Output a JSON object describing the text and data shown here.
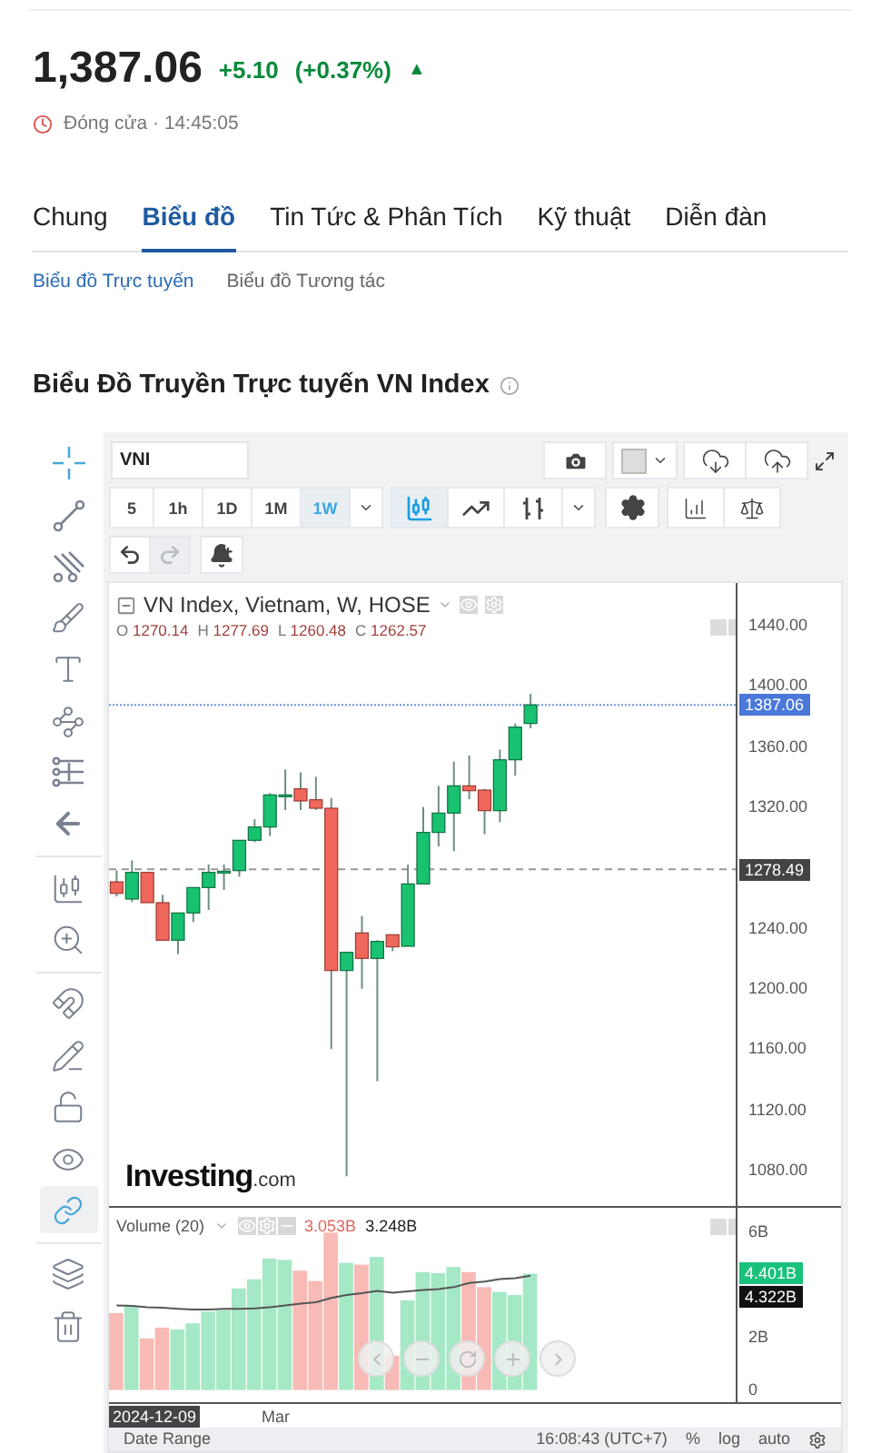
{
  "quote": {
    "price": "1,387.06",
    "change": "+5.10",
    "change_percent": "(+0.37%)",
    "arrow": "▲",
    "status": "Đóng cửa · 14:45:05"
  },
  "tabs": [
    {
      "label": "Chung",
      "selected": false
    },
    {
      "label": "Biểu đồ",
      "selected": true
    },
    {
      "label": "Tin Tức & Phân Tích",
      "selected": false
    },
    {
      "label": "Kỹ thuật",
      "selected": false
    },
    {
      "label": "Diễn đàn",
      "selected": false
    }
  ],
  "subtabs": [
    {
      "label": "Biểu đồ Trực tuyến",
      "selected": true
    },
    {
      "label": "Biểu đồ Tương tác",
      "selected": false
    }
  ],
  "section_title": "Biểu Đồ Truyền Trực tuyến VN Index",
  "chart_widget": {
    "symbol": "VNI",
    "intervals": [
      {
        "label": "5",
        "selected": false
      },
      {
        "label": "1h",
        "selected": false
      },
      {
        "label": "1D",
        "selected": false
      },
      {
        "label": "1M",
        "selected": false
      },
      {
        "label": "1W",
        "selected": true
      }
    ],
    "chart_types": [
      {
        "kind": "candles",
        "selected": true
      },
      {
        "kind": "line",
        "selected": false
      },
      {
        "kind": "bars",
        "selected": false
      }
    ],
    "history": [
      {
        "kind": "undo",
        "disabled": false
      },
      {
        "kind": "redo",
        "disabled": true
      }
    ],
    "left_tool_groups": [
      [
        {
          "kind": "crosshair",
          "selected": true
        },
        {
          "kind": "trend-line",
          "selected": false
        },
        {
          "kind": "fork",
          "selected": false
        },
        {
          "kind": "brush",
          "selected": false
        },
        {
          "kind": "text",
          "selected": false
        },
        {
          "kind": "pattern",
          "selected": false
        },
        {
          "kind": "measure",
          "selected": false
        },
        {
          "kind": "back",
          "selected": false
        }
      ],
      [
        {
          "kind": "candle-ruler",
          "selected": false
        },
        {
          "kind": "zoom",
          "selected": false
        }
      ],
      [
        {
          "kind": "magnet",
          "selected": false
        },
        {
          "kind": "pencil-lock",
          "selected": false
        },
        {
          "kind": "unlock",
          "selected": false
        },
        {
          "kind": "eye",
          "selected": false
        },
        {
          "kind": "link",
          "selected": true
        }
      ],
      [
        {
          "kind": "layers",
          "selected": false
        },
        {
          "kind": "trash",
          "selected": false
        }
      ]
    ],
    "price_chart": {
      "legend": {
        "title": "VN Index, Vietnam, W, HOSE",
        "ohlc": [
          {
            "label": "O",
            "value": "1270.14"
          },
          {
            "label": "H",
            "value": "1277.69"
          },
          {
            "label": "L",
            "value": "1260.48"
          },
          {
            "label": "C",
            "value": "1262.57"
          }
        ]
      },
      "watermark_logo": {
        "brand": "Investing",
        "suffix": ".com"
      },
      "chart_data": {
        "type": "candlestick",
        "categories": [
          null,
          null,
          null,
          null,
          null,
          null,
          null,
          null,
          null,
          null,
          null,
          null,
          null,
          null,
          null,
          null,
          null,
          null,
          null,
          null,
          null,
          null,
          null,
          null,
          null,
          null,
          null,
          null,
          null,
          null,
          null,
          null,
          null,
          null,
          null,
          null,
          null,
          null,
          null,
          null,
          null
        ],
        "ohlc": [
          [
            1270.14,
            1277.69,
            1260.48,
            1262.57
          ],
          [
            1258.8,
            1284.4,
            1256.8,
            1276.4
          ],
          [
            1276.4,
            1276.4,
            1256.4,
            1256.4
          ],
          [
            1256.4,
            1261.6,
            1231.6,
            1231.6
          ],
          [
            1231.6,
            1249.6,
            1222.4,
            1249.6
          ],
          [
            1249.6,
            1266.4,
            1243.6,
            1266.4
          ],
          [
            1266.4,
            1281.6,
            1251.6,
            1276.4
          ],
          [
            1276.4,
            1281.6,
            1264.8,
            1277.2
          ],
          [
            1277.6,
            1297.6,
            1273.6,
            1297.6
          ],
          [
            1297.6,
            1311.6,
            1296.4,
            1306.4
          ],
          [
            1306.4,
            1328.8,
            1300.4,
            1327.6
          ],
          [
            1326.8,
            1344.4,
            1317.6,
            1327.6
          ],
          [
            1331.6,
            1342.4,
            1317.6,
            1323.6
          ],
          [
            1324.4,
            1339.6,
            1317.6,
            1318.8
          ],
          [
            1318.8,
            1325.6,
            1159.6,
            1211.6
          ],
          [
            1211.6,
            1223.6,
            1075.6,
            1223.6
          ],
          [
            1236.4,
            1247.6,
            1199.6,
            1219.6
          ],
          [
            1219.6,
            1231.6,
            1138.4,
            1230.8
          ],
          [
            1235.2,
            1235.2,
            1224.4,
            1227.2
          ],
          [
            1227.6,
            1281.6,
            1227.6,
            1268.8
          ],
          [
            1268.8,
            1319.6,
            1268.8,
            1302.8
          ],
          [
            1302.8,
            1333.6,
            1293.6,
            1315.6
          ],
          [
            1315.6,
            1349.6,
            1290.4,
            1333.6
          ],
          [
            1333.6,
            1353.6,
            1324.8,
            1330.4
          ],
          [
            1330.8,
            1331.6,
            1301.6,
            1317.2
          ],
          [
            1317.2,
            1357.6,
            1309.6,
            1350.8
          ],
          [
            1350.8,
            1374.8,
            1340.4,
            1372.4
          ],
          [
            1374.8,
            1394.4,
            1371.6,
            1387.06
          ],
          null,
          null,
          null,
          null,
          null,
          null,
          null,
          null,
          null,
          null,
          null,
          null,
          null
        ],
        "ylim": [
          1056,
          1467.6
        ],
        "yticks": [
          {
            "value": 1440,
            "label": "1440.00"
          },
          {
            "value": 1400,
            "label": "1400.00"
          },
          {
            "value": 1360,
            "label": "1360.00"
          },
          {
            "value": 1320,
            "label": "1320.00"
          },
          {
            "value": 1240,
            "label": "1240.00"
          },
          {
            "value": 1200,
            "label": "1200.00"
          },
          {
            "value": 1160,
            "label": "1160.00"
          },
          {
            "value": 1120,
            "label": "1120.00"
          },
          {
            "value": 1080,
            "label": "1080.00"
          }
        ],
        "ref_lines": [
          {
            "axis": "y",
            "value": 1387.06,
            "label": "1387.06",
            "color": "#4a78d9"
          },
          {
            "axis": "y",
            "value": 1278.49,
            "label": "1278.49",
            "color": "#444444"
          }
        ]
      }
    },
    "volume": {
      "title": "Volume (20)",
      "value_1": "3.053B",
      "value_2": "3.248B",
      "last_volume_label": "4.401B",
      "average_label": "4.322B",
      "chart_data": {
        "type": "bar",
        "stacked": true,
        "categories": [
          null,
          null,
          null,
          null,
          null,
          null,
          null,
          null,
          null,
          null,
          null,
          null,
          null,
          null,
          null,
          null,
          null,
          null,
          null,
          null,
          null,
          null,
          null,
          null,
          null,
          null,
          null,
          null,
          null,
          null,
          null,
          null,
          null,
          null,
          null,
          null,
          null,
          null,
          null,
          null,
          null
        ],
        "series": [
          {
            "color": "#a5e8c6",
            "values": [
              null,
              3.16,
              null,
              null,
              2.29,
              2.52,
              2.97,
              3.02,
              3.84,
              4.19,
              4.97,
              4.92,
              null,
              null,
              null,
              4.81,
              null,
              5.03,
              null,
              3.39,
              4.46,
              4.42,
              4.65,
              null,
              null,
              3.71,
              3.59,
              4.4,
              null,
              null,
              null,
              null,
              null,
              null,
              null,
              null,
              null,
              null,
              null,
              null,
              null
            ]
          },
          {
            "color": "#f8bab4",
            "values": [
              2.91,
              null,
              1.95,
              2.36,
              null,
              null,
              null,
              null,
              null,
              null,
              null,
              null,
              4.51,
              4.12,
              5.95,
              null,
              4.74,
              null,
              1.3,
              null,
              null,
              null,
              null,
              4.46,
              3.89,
              null,
              null,
              null,
              null,
              null,
              null,
              null,
              null,
              null,
              null,
              null,
              null,
              null,
              null,
              null,
              null
            ]
          },
          {
            "type": "line",
            "color": "#555555",
            "values": [
              3.2,
              3.18,
              3.13,
              3.11,
              3.07,
              3.04,
              3.04,
              3.07,
              3.07,
              3.09,
              3.13,
              3.2,
              3.27,
              3.32,
              3.48,
              3.59,
              3.66,
              3.75,
              3.68,
              3.73,
              3.78,
              3.82,
              3.89,
              4.05,
              4.1,
              4.19,
              4.23,
              4.32,
              null,
              null,
              null,
              null,
              null,
              null,
              null,
              null,
              null,
              null,
              null,
              null,
              null
            ]
          }
        ],
        "ylim": [
          -0.46,
          6.89
        ],
        "yticks": [
          {
            "value": 6,
            "label": "6B"
          },
          {
            "value": 2,
            "label": "2B"
          },
          {
            "value": 0,
            "label": "0"
          }
        ]
      }
    },
    "time_axis": {
      "cursor_date": "2024-12-09",
      "labels": [
        "Mar"
      ]
    },
    "status_bar": {
      "date_range": "Date Range",
      "time": "16:08:43 (UTC+7)",
      "options": [
        "%",
        "log",
        "auto"
      ]
    }
  }
}
